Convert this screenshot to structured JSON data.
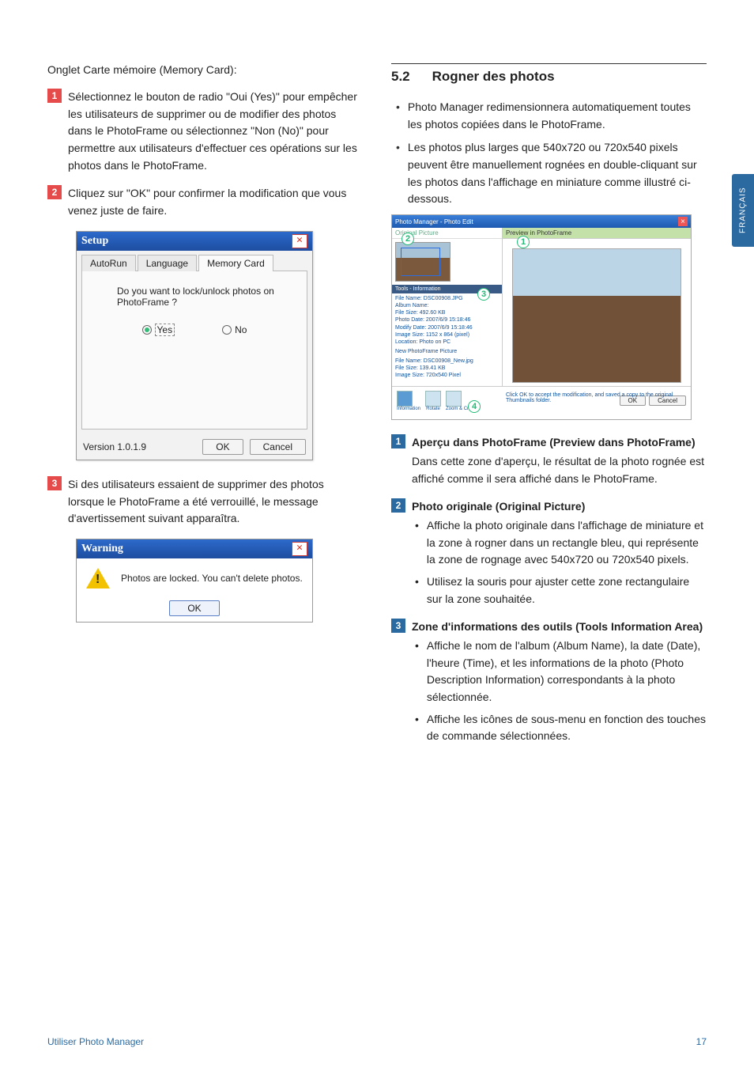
{
  "left": {
    "intro": "Onglet Carte mémoire (Memory Card):",
    "steps": {
      "s1": "Sélectionnez le bouton de radio \"Oui (Yes)\" pour empêcher les utilisateurs de supprimer ou de modifier des photos dans le PhotoFrame ou sélectionnez \"Non (No)\" pour permettre aux utilisateurs d'effectuer ces opérations sur les photos dans le PhotoFrame.",
      "s2": "Cliquez sur \"OK\" pour confirmer la modification que vous venez juste de faire.",
      "s3": "Si des utilisateurs essaient de supprimer des photos lorsque le PhotoFrame a été verrouillé, le message d'avertissement suivant apparaîtra."
    }
  },
  "setupDlg": {
    "title": "Setup",
    "tabs": {
      "t1": "AutoRun",
      "t2": "Language",
      "t3": "Memory Card"
    },
    "question": "Do you want to lock/unlock photos on PhotoFrame ?",
    "yes": "Yes",
    "no": "No",
    "version": "Version 1.0.1.9",
    "ok": "OK",
    "cancel": "Cancel"
  },
  "warnDlg": {
    "title": "Warning",
    "msg": "Photos are locked. You can't delete photos.",
    "ok": "OK"
  },
  "right": {
    "secNum": "5.2",
    "secTitle": "Rogner des photos",
    "bullets": {
      "b1": "Photo Manager redimensionnera automatiquement toutes les photos copiées dans le PhotoFrame.",
      "b2": "Les photos plus larges que 540x720 ou 720x540 pixels peuvent être manuellement rognées en double-cliquant sur les photos dans l'affichage en miniature comme illustré ci-dessous."
    },
    "features": {
      "f1": {
        "num": "1",
        "title": "Aperçu dans PhotoFrame (Preview dans PhotoFrame)",
        "body": "Dans cette zone d'aperçu, le résultat de la photo rognée est affiché comme il sera affiché dans le PhotoFrame."
      },
      "f2": {
        "num": "2",
        "title": "Photo originale (Original Picture)",
        "items": {
          "i1": "Affiche la photo originale dans l'affichage de miniature et la zone à rogner dans un rectangle bleu, qui représente la zone de rognage avec 540x720 ou 720x540 pixels.",
          "i2": "Utilisez la souris pour ajuster cette zone rectangulaire sur la zone souhaitée."
        }
      },
      "f3": {
        "num": "3",
        "title": "Zone d'informations des outils (Tools Information Area)",
        "items": {
          "i1": "Affiche le nom de l'album (Album Name), la date (Date), l'heure (Time), et les informations de la photo (Photo Description Information) correspondants à la photo sélectionnée.",
          "i2": "Affiche les icônes de sous-menu en fonction des touches de commande sélectionnées."
        }
      }
    }
  },
  "editShot": {
    "winTitle": "Photo Manager - Photo Edit",
    "leftHead": "Original Picture",
    "rightHead": "Preview in PhotoFrame",
    "infoHead": "Tools - Information",
    "lines": {
      "l1": "File Name:   DSC00908.JPG",
      "l2": "Album Name:",
      "l3": "File Size:   492.60 KB",
      "l4": "Photo Date:  2007/6/9 15:18:46",
      "l5": "Modify Date: 2007/6/9 15:18:46",
      "l6": "Image Size:  1152 x 864 (pixel)",
      "l7": "Location:    Photo on PC"
    },
    "newHead": "New PhotoFrame Picture",
    "newLines": {
      "n1": "File Name:  DSC00908_New.jpg",
      "n2": "File Size:  139.41 KB",
      "n3": "Image Size: 720x540 Pixel"
    },
    "hint": "Click OK to accept the modification, and saved a copy to the original Thumbnails folder.",
    "toolLabels": {
      "a": "Information",
      "b": "Rotate",
      "c": "Zoom & Crop"
    },
    "ok": "OK",
    "cancel": "Cancel"
  },
  "sideTab": "FRANÇAIS",
  "footer": {
    "left": "Utiliser Photo Manager",
    "right": "17"
  }
}
